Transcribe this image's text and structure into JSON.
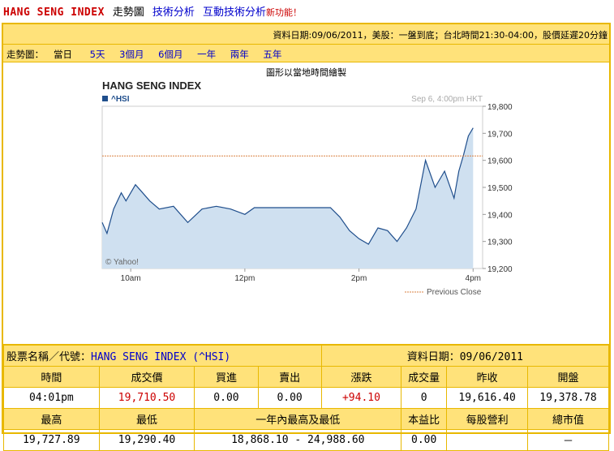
{
  "nav": {
    "title": "HANG SENG INDEX",
    "current": "走勢圖",
    "links": [
      "技術分析",
      "互動技術分析"
    ],
    "new_badge": "新功能！"
  },
  "info_bar": "資料日期:09/06/2011，美股：一盤到底；台北時間21:30-04:00，股價延遲20分鐘",
  "range_bar": {
    "label": "走勢圖：",
    "current": "當日",
    "links": [
      "5天",
      "3個月",
      "6個月",
      "一年",
      "兩年",
      "五年"
    ]
  },
  "chart": {
    "note": "圖形以當地時間繪製",
    "title": "HANG SENG INDEX",
    "series_label": "^HSI",
    "timestamp": "Sep 6, 4:00pm HKT",
    "watermark": "© Yahoo!",
    "legend": "Previous Close",
    "colors": {
      "line": "#1f4e8c",
      "fill": "#cfe0f0",
      "prev_close": "#d98040"
    }
  },
  "chart_data": {
    "type": "area",
    "title": "HANG SENG INDEX",
    "series": [
      {
        "name": "^HSI",
        "points": [
          [
            "09:30",
            19370
          ],
          [
            "09:35",
            19330
          ],
          [
            "09:42",
            19420
          ],
          [
            "09:50",
            19480
          ],
          [
            "09:55",
            19450
          ],
          [
            "10:05",
            19510
          ],
          [
            "10:10",
            19490
          ],
          [
            "10:20",
            19450
          ],
          [
            "10:30",
            19420
          ],
          [
            "10:45",
            19430
          ],
          [
            "11:00",
            19370
          ],
          [
            "11:15",
            19420
          ],
          [
            "11:30",
            19430
          ],
          [
            "11:45",
            19420
          ],
          [
            "12:00",
            19400
          ],
          [
            "12:10",
            19425
          ],
          [
            "13:30",
            19425
          ],
          [
            "13:40",
            19390
          ],
          [
            "13:50",
            19340
          ],
          [
            "14:00",
            19310
          ],
          [
            "14:10",
            19290
          ],
          [
            "14:20",
            19350
          ],
          [
            "14:30",
            19340
          ],
          [
            "14:40",
            19300
          ],
          [
            "14:50",
            19350
          ],
          [
            "15:00",
            19420
          ],
          [
            "15:10",
            19600
          ],
          [
            "15:20",
            19500
          ],
          [
            "15:30",
            19560
          ],
          [
            "15:40",
            19460
          ],
          [
            "15:45",
            19560
          ],
          [
            "15:50",
            19620
          ],
          [
            "15:55",
            19690
          ],
          [
            "16:00",
            19720
          ]
        ]
      }
    ],
    "previous_close": 19616.4,
    "ylim": [
      19200,
      19800
    ],
    "yticks": [
      "19,800",
      "19,700",
      "19,600",
      "19,500",
      "19,400",
      "19,300",
      "19,200"
    ],
    "xticks": [
      "10am",
      "12pm",
      "2pm",
      "4pm"
    ],
    "xlim": [
      "09:30",
      "16:10"
    ]
  },
  "quote": {
    "name_label": "股票名稱／代號：",
    "name_value": "HANG SENG INDEX (^HSI)",
    "date_label": "資料日期：",
    "date_value": "09/06/2011",
    "row1_headers": [
      "時間",
      "成交價",
      "買進",
      "賣出",
      "漲跌",
      "成交量",
      "昨收",
      "開盤"
    ],
    "row1_values": [
      "04:01pm",
      "19,710.50",
      "0.00",
      "0.00",
      "+94.10",
      "0",
      "19,616.40",
      "19,378.78"
    ],
    "row2_headers": [
      "最高",
      "最低",
      "一年內最高及最低",
      "本益比",
      "每股營利",
      "總市值"
    ],
    "row2_values": [
      "19,727.89",
      "19,290.40",
      "18,868.10 - 24,988.60",
      "0.00",
      "",
      "－"
    ]
  }
}
